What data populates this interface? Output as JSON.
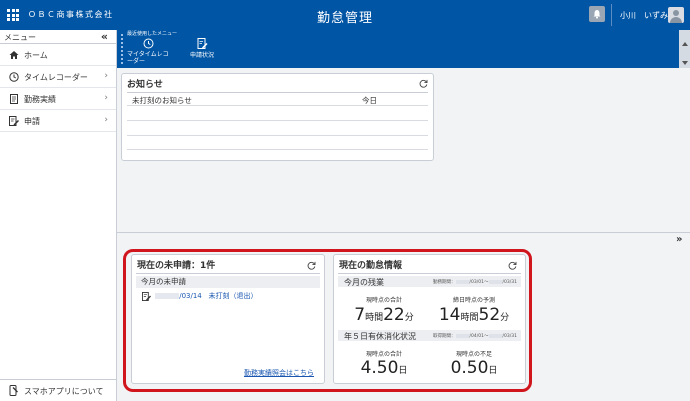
{
  "header": {
    "company": "ＯＢＣ商事株式会社",
    "app_title": "勤怠管理",
    "user_name": "小川　いずみ"
  },
  "sidebar": {
    "menu_label": "メニュー",
    "collapse_glyph": "«",
    "items": [
      {
        "label": "ホーム",
        "icon": "home-icon",
        "has_submenu": false
      },
      {
        "label": "タイムレコーダー",
        "icon": "clock-icon",
        "has_submenu": true
      },
      {
        "label": "勤務実績",
        "icon": "document-icon",
        "has_submenu": true
      },
      {
        "label": "申請",
        "icon": "edit-document-icon",
        "has_submenu": true
      }
    ],
    "footer_label": "スマホアプリについて"
  },
  "toolbar": {
    "caption": "最近使用したメニュー",
    "btn1": "マイタイムレコーダー",
    "btn2": "申請状況"
  },
  "notices": {
    "title": "お知らせ",
    "col1": "未打刻のお知らせ",
    "col2": "今日"
  },
  "pending": {
    "title": "現在の未申請：1件",
    "subheader": "今月の未申請",
    "item_date": "/03/14",
    "item_text": "未打刻（退出）",
    "link": "勤務実績照会はこちら"
  },
  "status": {
    "title": "現在の勤怠情報",
    "overtime": {
      "label": "今月の残業",
      "period_prefix": "勤務期間：",
      "period_from": "/03/01",
      "period_to": "/03/31",
      "current_caption": "現時点の合計",
      "current_hours": "7",
      "current_minutes": "22",
      "forecast_caption": "締日時点の予測",
      "forecast_hours": "14",
      "forecast_minutes": "52",
      "unit_hours": "時間",
      "unit_minutes": "分"
    },
    "leave": {
      "label": "年５日有休消化状況",
      "period_prefix": "取得期間：",
      "period_from": "/04/01",
      "period_to": "/03/31",
      "total_caption": "現時点の合計",
      "total_value": "4.50",
      "shortfall_caption": "現時点の不足",
      "shortfall_value": "0.50",
      "unit_days": "日"
    }
  },
  "colors": {
    "brand_blue": "#0055a5",
    "highlight_red": "#d0151c",
    "link_blue": "#1a56b0"
  }
}
